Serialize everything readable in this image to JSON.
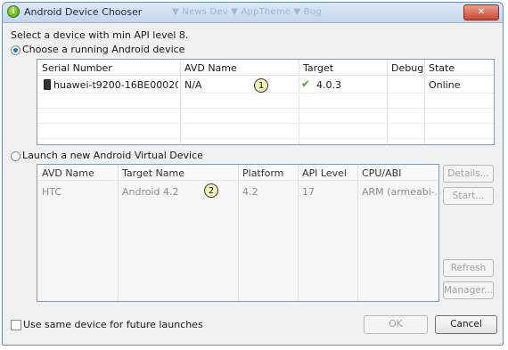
{
  "window": {
    "title": "Android Device Chooser",
    "background_tabs": "▼  News Dev    ▼  AppTheme    ▼  Bug",
    "close_label": "✕"
  },
  "intro_text": "Select a device with min API level 8.",
  "running": {
    "radio_label": "Choose a running Android device",
    "columns": [
      "Serial Number",
      "AVD Name",
      "Target",
      "Debug",
      "State"
    ],
    "rows": [
      {
        "serial": "huawei-t9200-16BE0002000...",
        "avd_name": "N/A",
        "target": "4.0.3",
        "debug": "",
        "state": "Online",
        "badge": "1"
      }
    ]
  },
  "launch": {
    "radio_label": "Launch a new Android Virtual Device",
    "columns": [
      "AVD Name",
      "Target Name",
      "Platform",
      "API Level",
      "CPU/ABI"
    ],
    "rows": [
      {
        "avd_name": "HTC",
        "target_name": "Android 4.2",
        "platform": "4.2",
        "api_level": "17",
        "cpu_abi": "ARM (armeabi-...",
        "badge": "2"
      }
    ],
    "buttons": {
      "details": "Details...",
      "start": "Start...",
      "refresh": "Refresh",
      "manager": "Manager..."
    }
  },
  "footer": {
    "checkbox_label": "Use same device for future launches",
    "ok_label": "OK",
    "cancel_label": "Cancel"
  },
  "colors": {
    "accent": "#2c6fc7",
    "check": "#3fa928",
    "badge": "#f6f3b7"
  }
}
